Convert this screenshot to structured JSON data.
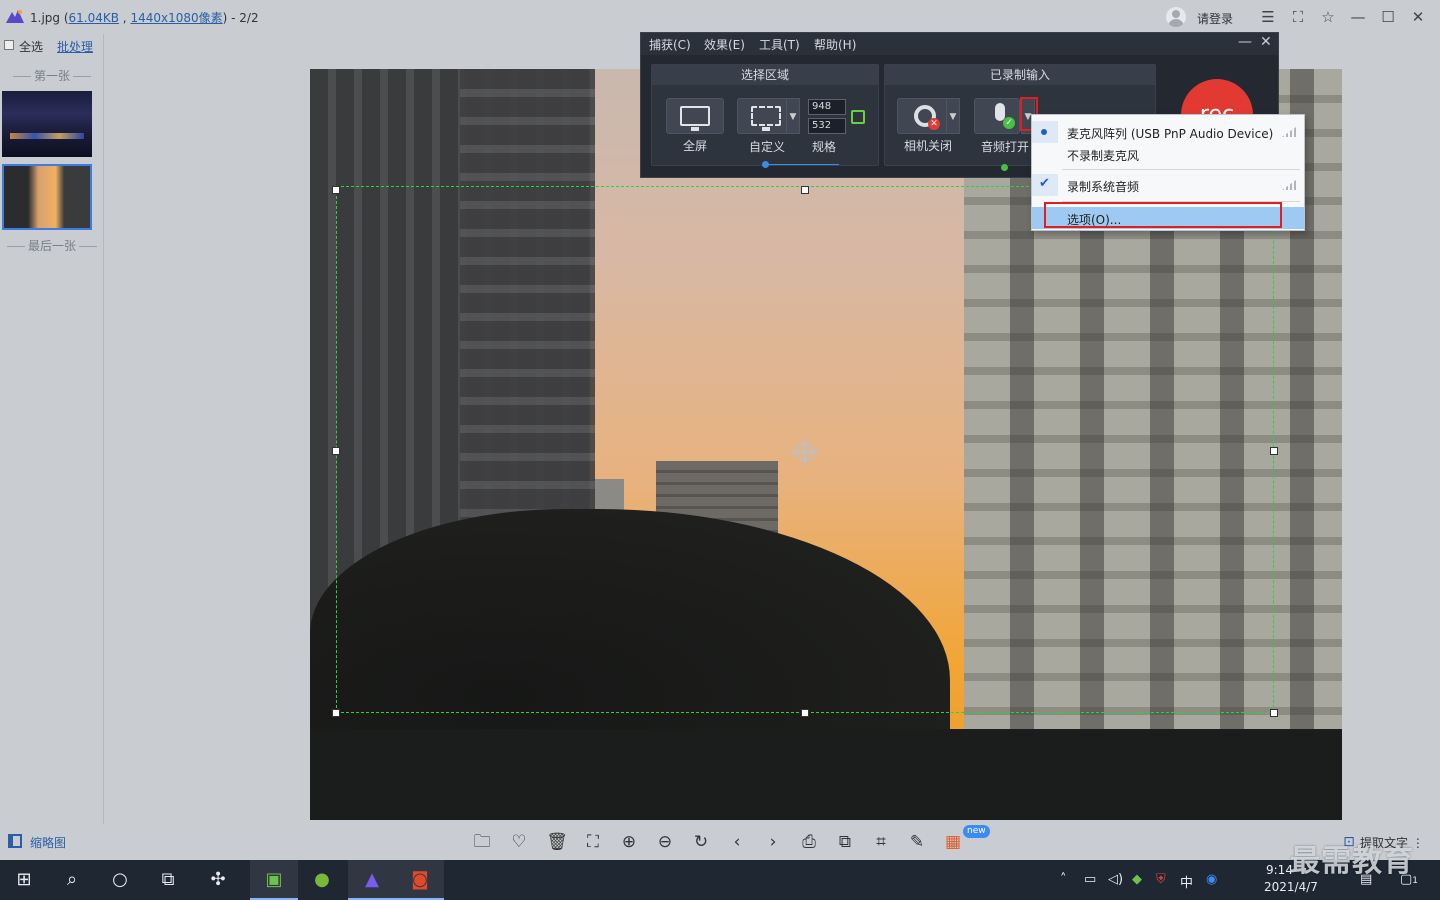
{
  "viewer": {
    "title": {
      "filename": "1.jpg (",
      "filesize": "61.04KB",
      "sep": " , ",
      "dimensions": "1440x1080像素",
      "suffix": ") - 2/2"
    },
    "login": "请登录",
    "controls": {
      "menu": "☰",
      "fullscreen": "⛶",
      "pin": "☆",
      "minimize": "—",
      "maximize": "☐",
      "close": "✕"
    }
  },
  "sidebar": {
    "select_all": "全选",
    "batch": "批处理",
    "first_label": "第一张",
    "last_label": "最后一张"
  },
  "bottombar": {
    "thumbnail_view": "缩略图",
    "new_badge": "new",
    "extract_text": "提取文字",
    "more": "⋮"
  },
  "recorder": {
    "menus": [
      "捕获(C)",
      "效果(E)",
      "工具(T)",
      "帮助(H)"
    ],
    "select_area": {
      "title": "选择区域",
      "fullscreen": "全屏",
      "custom": "自定义",
      "size": "规格",
      "width": "948",
      "height": "532"
    },
    "recorded_input": {
      "title": "已录制输入",
      "camera": "相机关闭",
      "audio": "音频打开"
    },
    "rec": "rec"
  },
  "audio_menu": {
    "items": [
      {
        "label": "麦克风阵列 (USB PnP Audio Device)"
      },
      {
        "label": "不录制麦克风"
      },
      {
        "label": "录制系统音频"
      },
      {
        "label": "选项(O)..."
      }
    ]
  },
  "taskbar": {
    "input_method": "中",
    "time": "9:14",
    "date": "2021/4/7",
    "notification_count": "1"
  },
  "watermark": "最需教育"
}
